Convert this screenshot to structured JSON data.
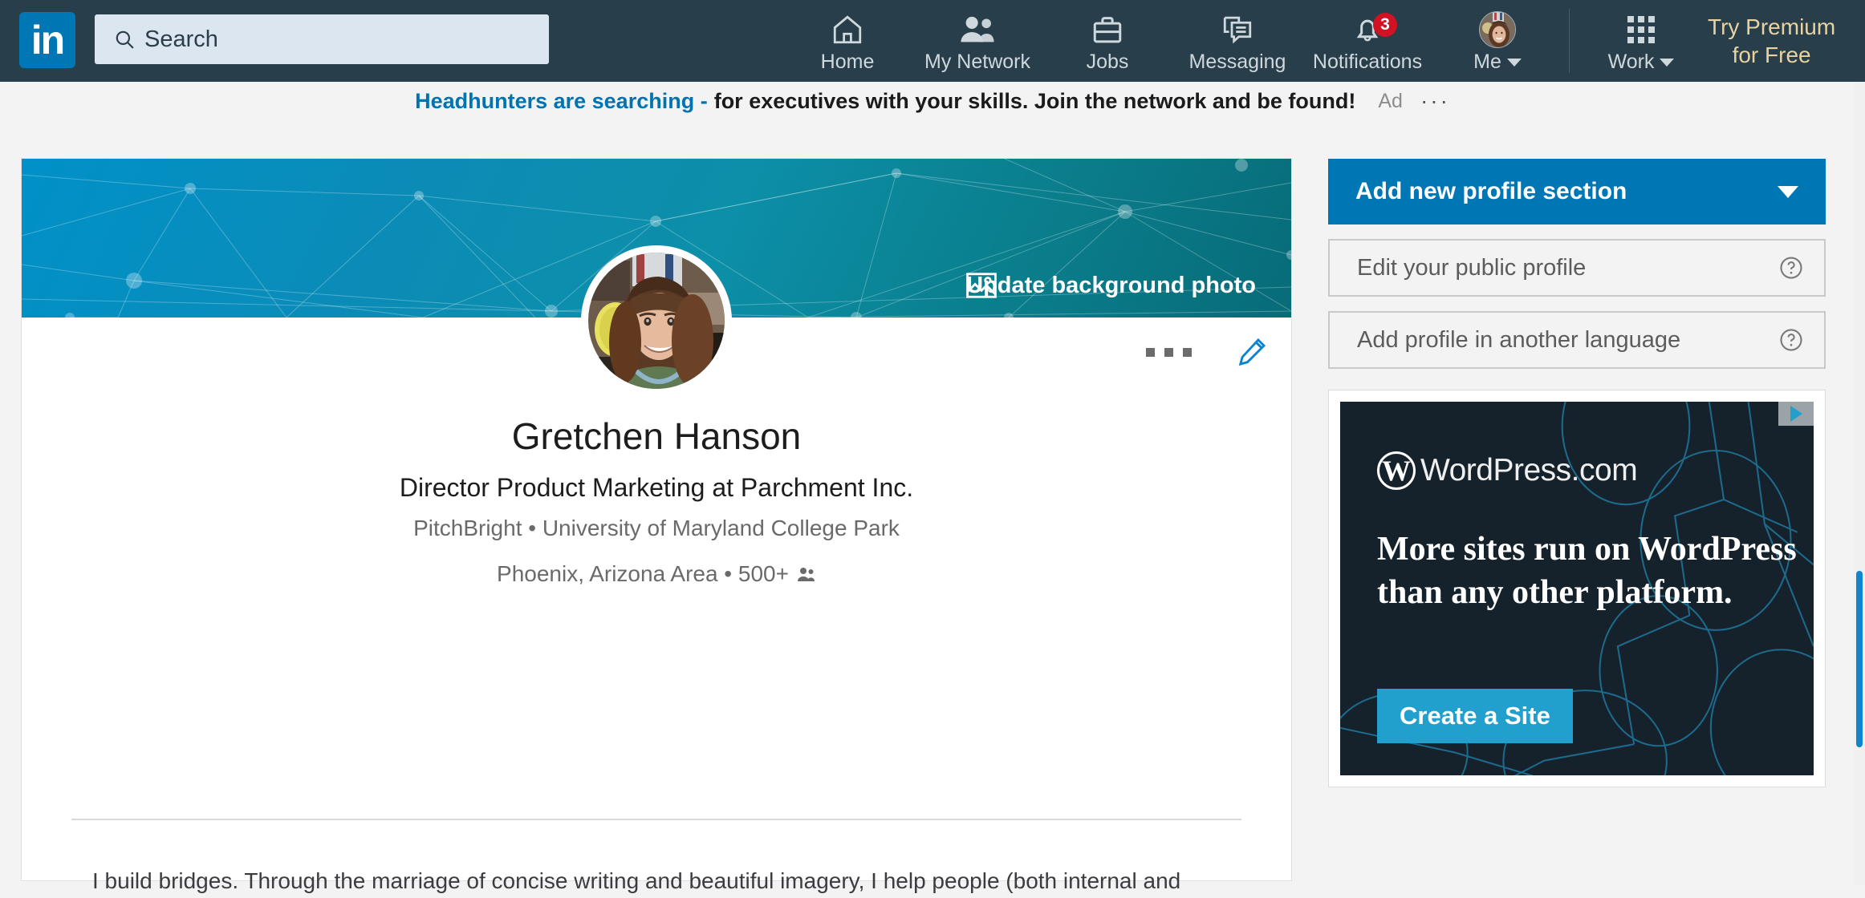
{
  "brand": {
    "logo_text": "in",
    "primary_color": "#0077b5",
    "nav_bg": "#283e4a",
    "premium_color": "#e7d2a4",
    "badge_color": "#d11124"
  },
  "search": {
    "placeholder": "Search",
    "value": "",
    "icon": "search-icon"
  },
  "nav": {
    "items": [
      {
        "label": "Home",
        "icon": "home-icon"
      },
      {
        "label": "My Network",
        "icon": "people-icon"
      },
      {
        "label": "Jobs",
        "icon": "briefcase-icon"
      },
      {
        "label": "Messaging",
        "icon": "message-icon"
      },
      {
        "label": "Notifications",
        "icon": "bell-icon",
        "badge": "3"
      },
      {
        "label": "Me",
        "icon": "avatar-icon",
        "caret": true
      },
      {
        "label": "Work",
        "icon": "grid-icon",
        "caret": true
      }
    ],
    "premium": {
      "line1": "Try Premium",
      "line2": "for Free"
    }
  },
  "ad_strip": {
    "highlight": "Headhunters are searching -",
    "body": "for executives with your skills. Join the network and be found!",
    "tag": "Ad",
    "overflow": "···"
  },
  "profile": {
    "update_background_label": "Update background photo",
    "name": "Gretchen Hanson",
    "headline": "Director Product Marketing at Parchment Inc.",
    "subline": "PitchBright • University of Maryland College Park",
    "location": "Phoenix, Arizona Area • 500+",
    "summary": "I build bridges. Through the marriage of concise writing and beautiful imagery, I help people (both internal and",
    "cover_gradient_start": "#0091c8",
    "cover_gradient_end": "#086b78"
  },
  "right_rail": {
    "primary_button": "Add new profile section",
    "buttons": [
      {
        "label": "Edit your public profile",
        "icon": "help-circle-icon"
      },
      {
        "label": "Add profile in another language",
        "icon": "help-circle-icon"
      }
    ]
  },
  "advert": {
    "brand_mark": "W",
    "brand_word": "WordPress.com",
    "headline": "More sites run on WordPress than any other platform.",
    "cta": "Create a Site",
    "cta_color": "#21a0ce",
    "bg_color": "#16222b"
  }
}
